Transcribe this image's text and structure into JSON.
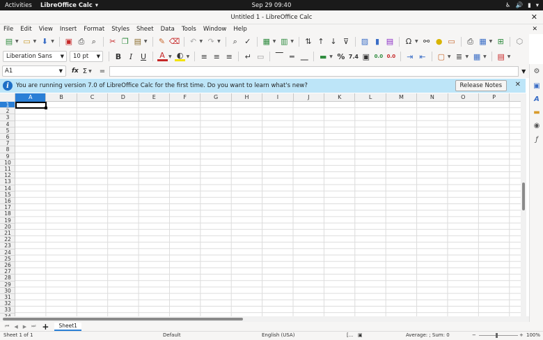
{
  "system": {
    "activities": "Activities",
    "app_name": "LibreOffice Calc",
    "clock": "Sep 29  09:40"
  },
  "window": {
    "title": "Untitled 1 - LibreOffice Calc"
  },
  "menu": [
    "File",
    "Edit",
    "View",
    "Insert",
    "Format",
    "Styles",
    "Sheet",
    "Data",
    "Tools",
    "Window",
    "Help"
  ],
  "format": {
    "font_name": "Liberation Sans",
    "font_size": "10 pt",
    "percent": "%",
    "decimal": "7.4",
    "add_decimal": "0.0",
    "del_decimal": "0.0"
  },
  "formula": {
    "name_box": "A1",
    "fx": "fx",
    "sigma": "Σ",
    "equals": "="
  },
  "infobar": {
    "message": "You are running version 7.0 of LibreOffice Calc for the first time. Do you want to learn what's new?",
    "button": "Release Notes"
  },
  "grid": {
    "columns": [
      "A",
      "B",
      "C",
      "D",
      "E",
      "F",
      "G",
      "H",
      "I",
      "J",
      "K",
      "L",
      "M",
      "N",
      "O",
      "P"
    ],
    "rows": [
      "1",
      "2",
      "3",
      "4",
      "5",
      "6",
      "7",
      "8",
      "9",
      "10",
      "11",
      "12",
      "13",
      "14",
      "15",
      "16",
      "17",
      "18",
      "19",
      "20",
      "21",
      "22",
      "23",
      "24",
      "25",
      "26",
      "27",
      "28",
      "29",
      "30",
      "31",
      "32",
      "33",
      "34"
    ],
    "selected_cell": "A1"
  },
  "tabs": {
    "sheets": [
      "Sheet1"
    ]
  },
  "statusbar": {
    "sheet_info": "Sheet 1 of 1",
    "page_style": "Default",
    "language": "English (USA)",
    "selection_mode": "[...",
    "summary": "Average: ; Sum: 0",
    "zoom_minus": "−",
    "zoom_plus": "+",
    "zoom": "100%"
  }
}
